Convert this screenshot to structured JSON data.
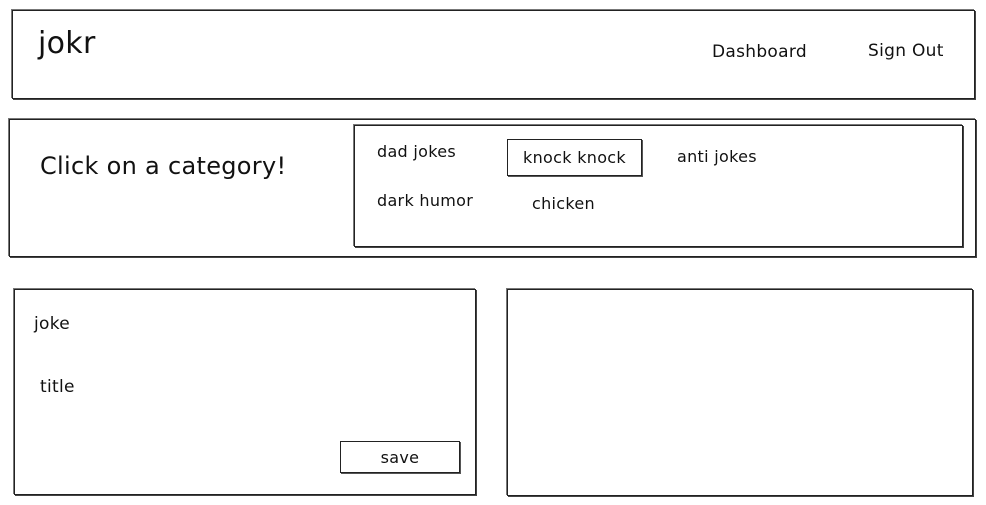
{
  "header": {
    "logo": "jokr",
    "nav": [
      "Dashboard",
      "Sign Out"
    ]
  },
  "categories_panel": {
    "prompt": "Click on a category!",
    "items": [
      "dad jokes",
      "knock knock",
      "anti jokes",
      "dark humor",
      "chicken"
    ],
    "selected": "knock knock"
  },
  "joke_form": {
    "joke_label": "joke",
    "title_label": "title",
    "save_label": "save"
  }
}
